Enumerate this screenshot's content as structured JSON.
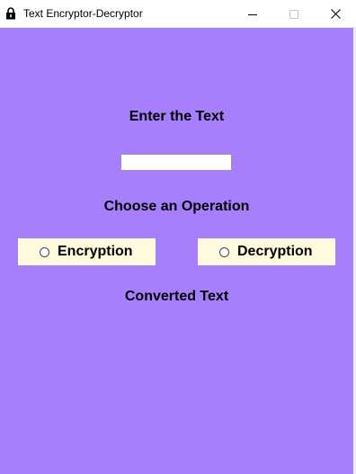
{
  "window": {
    "title": "Text Encryptor-Decryptor"
  },
  "icons": {
    "app": "lock-icon",
    "minimize": "minimize-icon",
    "maximize": "maximize-icon",
    "close": "close-icon"
  },
  "colors": {
    "background": "#a77ffd",
    "radio_background": "#fffbdf",
    "entry_background": "#ffffff"
  },
  "main": {
    "enter_label": "Enter the Text",
    "text_input_value": "",
    "operation_label": "Choose an Operation",
    "options": [
      {
        "label": "Encryption",
        "selected": false
      },
      {
        "label": "Decryption",
        "selected": false
      }
    ],
    "converted_label": "Converted Text"
  }
}
